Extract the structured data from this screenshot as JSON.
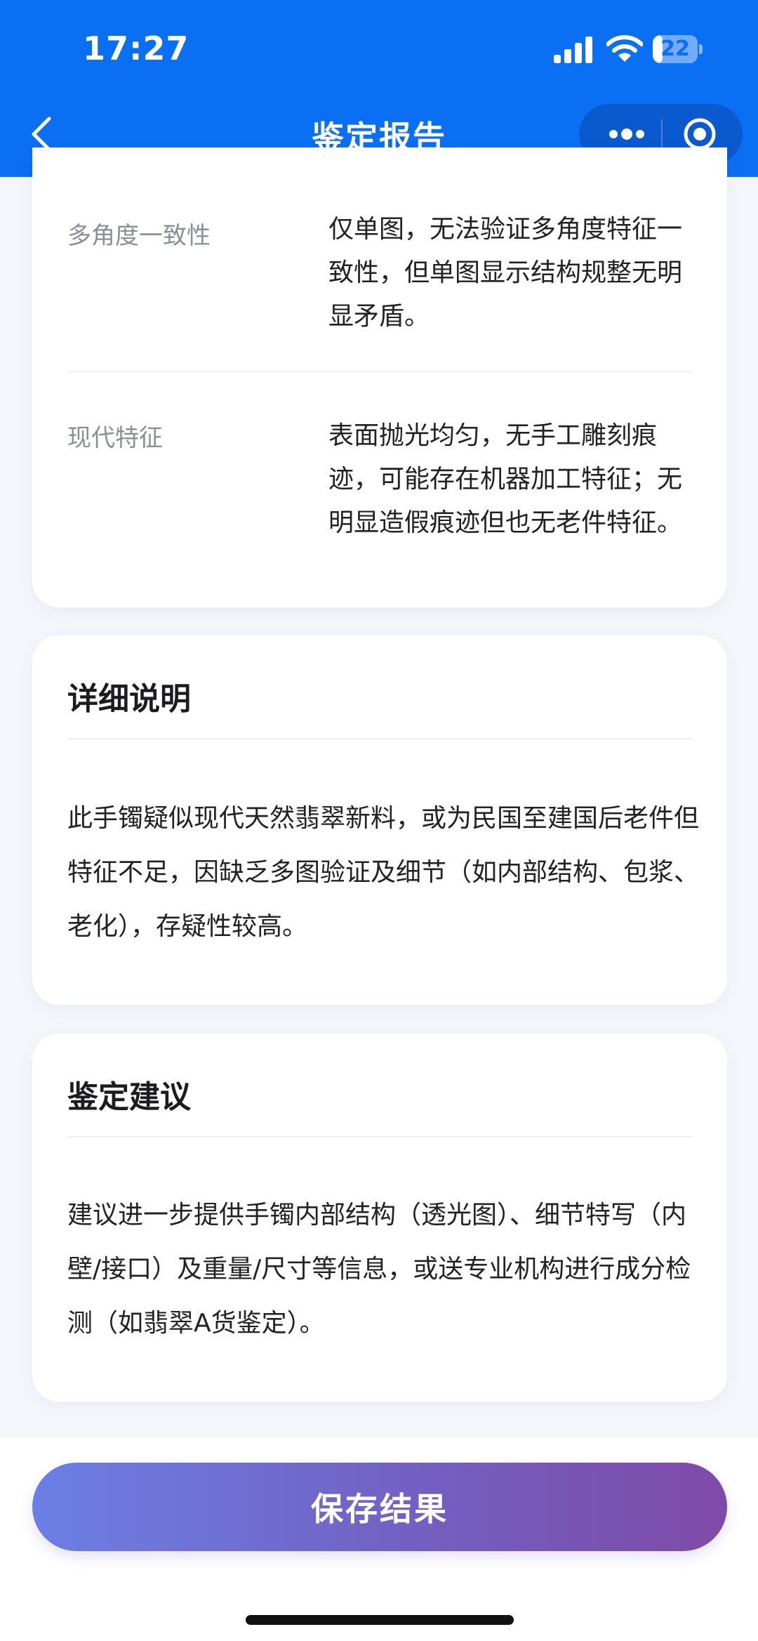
{
  "status_bar": {
    "time": "17:27",
    "battery": "22",
    "battery_level": 0.22
  },
  "nav": {
    "title": "鉴定报告"
  },
  "analysis": {
    "rows": [
      {
        "label": "多角度一致性",
        "value": "仅单图，无法验证多角度特征一致性，但单图显示结构规整无明显矛盾。"
      },
      {
        "label": "现代特征",
        "value": "表面抛光均匀，无手工雕刻痕迹，可能存在机器加工特征；无明显造假痕迹但也无老件特征。"
      }
    ]
  },
  "details": {
    "title": "详细说明",
    "body": "此手镯疑似现代天然翡翠新料，或为民国至建国后老件但特征不足，因缺乏多图验证及细节（如内部结构、包浆、老化），存疑性较高。"
  },
  "suggestion": {
    "title": "鉴定建议",
    "body": "建议进一步提供手镯内部结构（透光图）、细节特写（内壁/接口）及重量/尺寸等信息，或送专业机构进行成分检测（如翡翠A货鉴定）。"
  },
  "actions": {
    "save_label": "保存结果"
  },
  "colors": {
    "nav_bg": "#0b6ff4",
    "capsule_bg": "#0a59cf",
    "button_gradient_start": "#6c7fe4",
    "button_gradient_end": "#7f4aa8"
  }
}
